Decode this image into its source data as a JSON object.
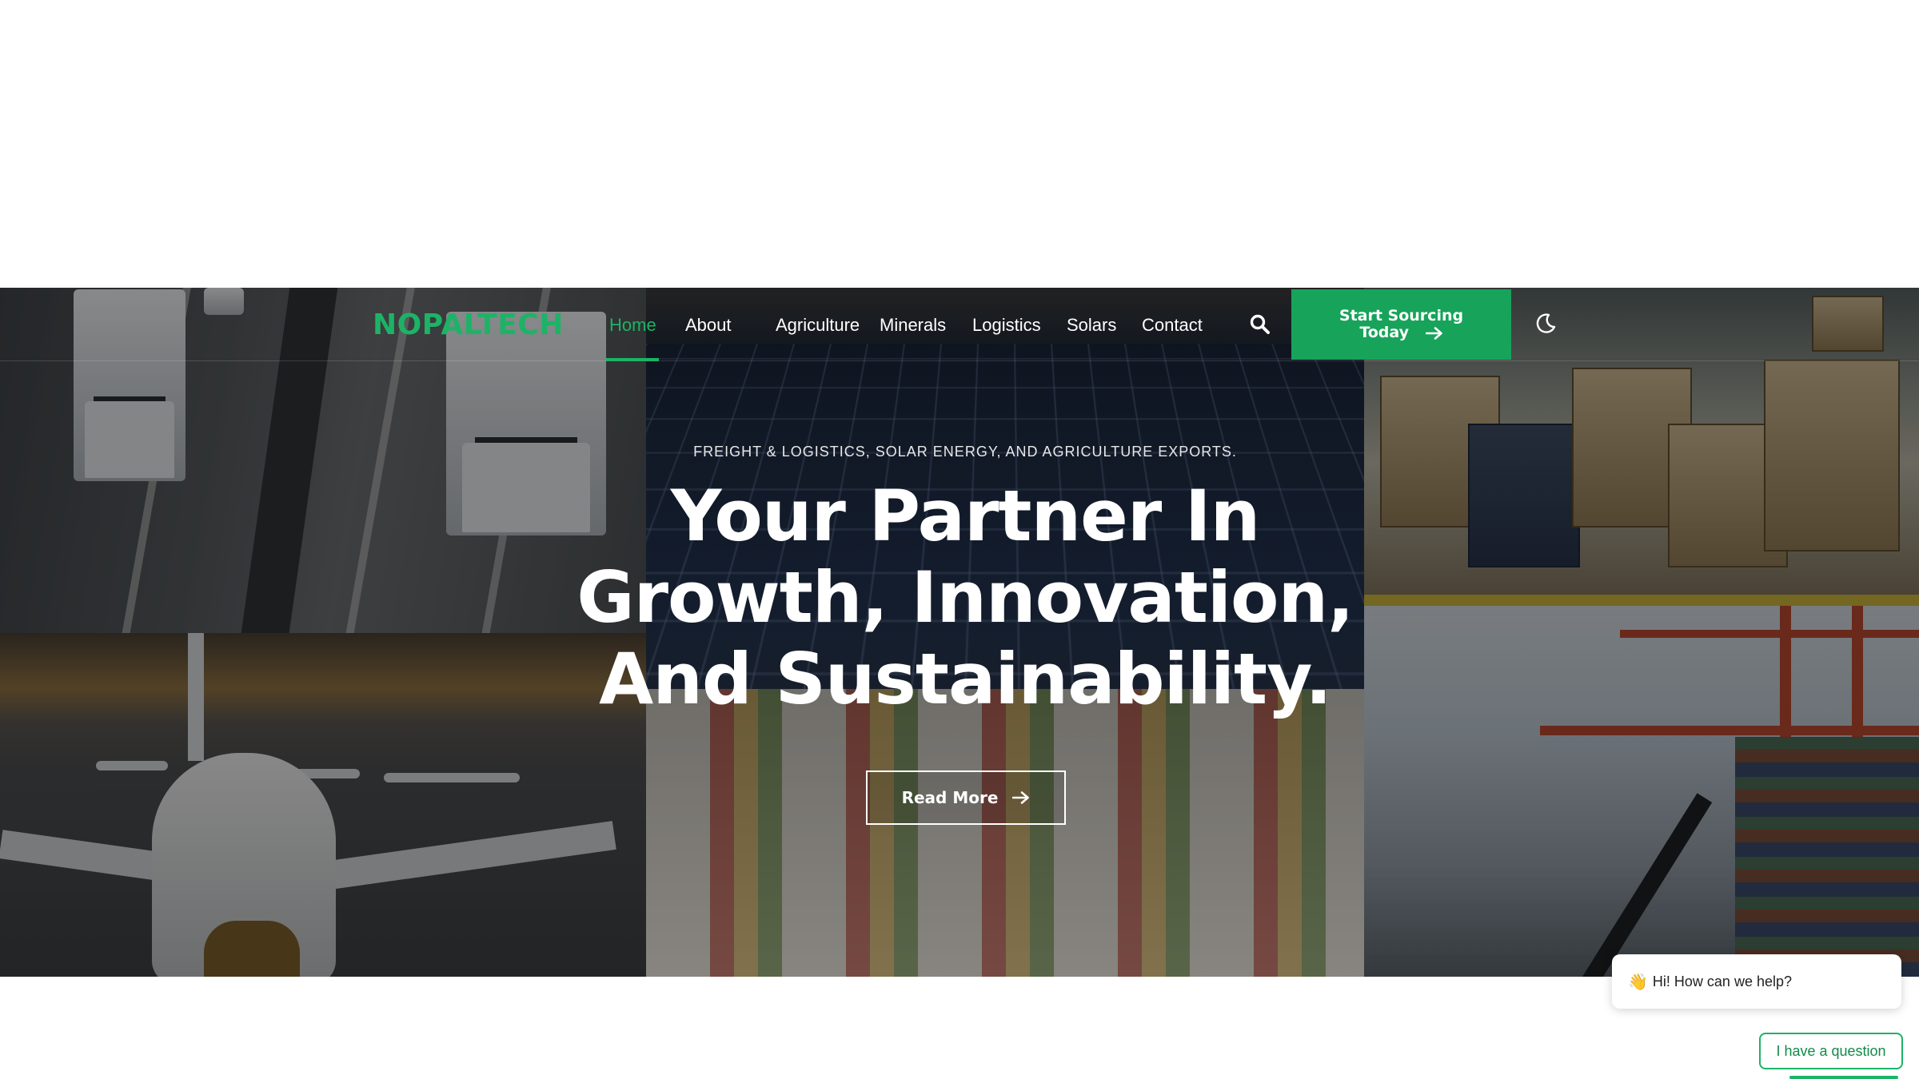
{
  "brand": {
    "logo": "NOPALTECH",
    "accent_color": "#1db366",
    "button_color": "#17a35a"
  },
  "nav": {
    "items": [
      {
        "label": "Home",
        "active": true
      },
      {
        "label": "About",
        "active": false
      },
      {
        "label": "Agriculture",
        "active": false
      },
      {
        "label": "Minerals",
        "active": false
      },
      {
        "label": "Logistics",
        "active": false
      },
      {
        "label": "Solars",
        "active": false
      },
      {
        "label": "Contact",
        "active": false
      }
    ],
    "search_icon": "search-icon",
    "cta_line1": "Start Sourcing",
    "cta_line2": "Today",
    "cta_icon": "arrow-right-icon",
    "theme_icon": "moon-icon"
  },
  "hero": {
    "eyebrow": "FREIGHT & LOGISTICS, SOLAR ENERGY, AND AGRICULTURE EXPORTS.",
    "headline_line1": "Your Partner In",
    "headline_line2": "Growth, Innovation,",
    "headline_line3": "And Sustainability.",
    "button_label": "Read More",
    "button_icon": "arrow-right-icon",
    "background_images": [
      "highway-trucks",
      "solar-panels-produce",
      "warehouse-pallets",
      "airport-cargo-plane",
      "port-cranes"
    ]
  },
  "chat": {
    "icon": "waving-hand-icon",
    "greeting": "Hi! How can we help?",
    "question_button": "I have a question"
  }
}
